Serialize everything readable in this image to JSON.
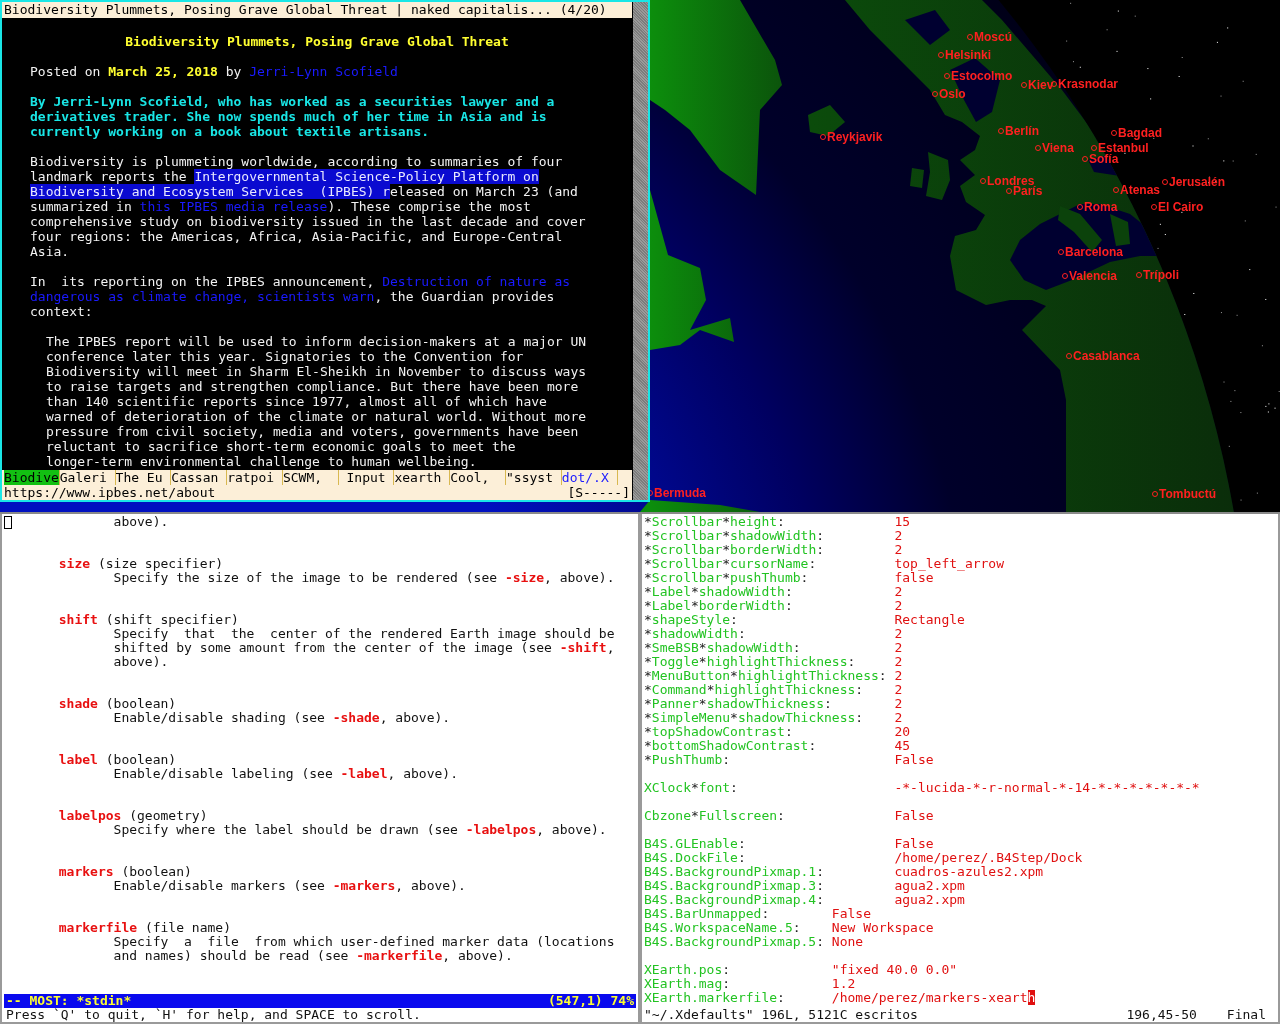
{
  "browser": {
    "title": "Biodiversity Plummets, Posing Grave Global Threat | naked capitalis... (4/20)",
    "paragraphs": [
      {
        "kind": "heading",
        "lines": [
          [
            {
              "kind": "text",
              "text": "Biodiversity Plummets, Posing Grave Global Threat"
            }
          ]
        ]
      },
      {
        "kind": "byline",
        "lines": [
          [
            {
              "kind": "text",
              "text": "Posted on "
            },
            {
              "kind": "strong",
              "text": "March 25, 2018"
            },
            {
              "kind": "text",
              "text": " by "
            },
            {
              "kind": "link",
              "text": "Jerri-Lynn Scofield"
            }
          ]
        ]
      },
      {
        "kind": "intro",
        "lines": [
          [
            {
              "kind": "text",
              "text": "By Jerri-Lynn Scofield, who has worked as a securities lawyer and a"
            }
          ],
          [
            {
              "kind": "text",
              "text": "derivatives trader. She now spends much of her time in Asia and is"
            }
          ],
          [
            {
              "kind": "text",
              "text": "currently working on a book about textile artisans."
            }
          ]
        ]
      },
      {
        "kind": "body",
        "lines": [
          [
            {
              "kind": "text",
              "text": "Biodiversity is plummeting worldwide, according to summaries of four"
            }
          ],
          [
            {
              "kind": "text",
              "text": "landmark reports the "
            },
            {
              "kind": "selected-link",
              "text": "Intergovernmental Science-Policy Platform on"
            }
          ],
          [
            {
              "kind": "selected-link",
              "text": "Biodiversity and Ecosystem Services  (IPBES) r"
            },
            {
              "kind": "text",
              "text": "eleased on March 23 (and"
            }
          ],
          [
            {
              "kind": "text",
              "text": "summarized in "
            },
            {
              "kind": "link",
              "text": "this IPBES media release"
            },
            {
              "kind": "text",
              "text": "). These comprise the most"
            }
          ],
          [
            {
              "kind": "text",
              "text": "comprehensive study on biodiversity issued in the last decade and cover"
            }
          ],
          [
            {
              "kind": "text",
              "text": "four regions: the Americas, Africa, Asia-Pacific, and Europe-Central"
            }
          ],
          [
            {
              "kind": "text",
              "text": "Asia."
            }
          ]
        ]
      },
      {
        "kind": "body",
        "lines": [
          [
            {
              "kind": "text",
              "text": "In  its reporting on the IPBES announcement, "
            },
            {
              "kind": "link",
              "text": "Destruction of nature as"
            }
          ],
          [
            {
              "kind": "link",
              "text": "dangerous as climate change, scientists warn"
            },
            {
              "kind": "text",
              "text": ", the Guardian provides"
            }
          ],
          [
            {
              "kind": "text",
              "text": "context:"
            }
          ]
        ]
      },
      {
        "kind": "quote",
        "lines": [
          [
            {
              "kind": "text",
              "text": "The IPBES report will be used to inform decision-makers at a major UN"
            }
          ],
          [
            {
              "kind": "text",
              "text": "conference later this year. Signatories to the Convention for"
            }
          ],
          [
            {
              "kind": "text",
              "text": "Biodiversity will meet in Sharm El-Sheikh in November to discuss ways"
            }
          ],
          [
            {
              "kind": "text",
              "text": "to raise targets and strengthen compliance. But there have been more"
            }
          ],
          [
            {
              "kind": "text",
              "text": "than 140 scientific reports since 1977, almost all of which have"
            }
          ],
          [
            {
              "kind": "text",
              "text": "warned of deterioration of the climate or natural world. Without more"
            }
          ],
          [
            {
              "kind": "text",
              "text": "pressure from civil society, media and voters, governments have been"
            }
          ],
          [
            {
              "kind": "text",
              "text": "reluctant to sacrifice short-term economic goals to meet the"
            }
          ],
          [
            {
              "kind": "text",
              "text": "longer-term environmental challenge to human wellbeing."
            }
          ]
        ]
      }
    ],
    "tabs": [
      {
        "label": "Biodive",
        "selected": true,
        "highlighted": false
      },
      {
        "label": "Galeri",
        "selected": false,
        "highlighted": false
      },
      {
        "label": "The Eu",
        "selected": false,
        "highlighted": false
      },
      {
        "label": "Cassan",
        "selected": false,
        "highlighted": false
      },
      {
        "label": "ratpoi",
        "selected": false,
        "highlighted": false
      },
      {
        "label": "SCWM,",
        "selected": false,
        "highlighted": false
      },
      {
        "label": " Input",
        "selected": false,
        "highlighted": false
      },
      {
        "label": "xearth",
        "selected": false,
        "highlighted": false
      },
      {
        "label": "Cool,",
        "selected": false,
        "highlighted": false
      },
      {
        "label": "\"ssyst",
        "selected": false,
        "highlighted": false
      },
      {
        "label": "dot/.X",
        "selected": false,
        "highlighted": true
      }
    ],
    "url": "https://www.ipbes.net/about",
    "status": "[S-----]"
  },
  "globe": {
    "cities": [
      "Moscú",
      "Helsinki",
      "Estocolmo",
      "Oslo",
      "Kiev",
      "Krasnodar",
      "Reykjavik",
      "Berlín",
      "Bagdad",
      "Viena",
      "Estanbul",
      "Sofía",
      "Londres",
      "París",
      "Atenas",
      "Jerusalén",
      "Roma",
      "El Cairo",
      "Barcelona",
      "Valencia",
      "Trípoli",
      "Casablanca",
      "Bermuda",
      "Tombuctú"
    ]
  },
  "manpage": {
    "lead": "above).",
    "entries": [
      {
        "term": "size",
        "arg": "(size specifier)",
        "description": [
          {
            "kind": "text",
            "text": "Specify the size of the image to be rendered (see "
          },
          {
            "kind": "ref",
            "text": "-size"
          },
          {
            "kind": "text",
            "text": ", above)."
          }
        ]
      },
      {
        "term": "shift",
        "arg": "(shift specifier)",
        "description": [
          {
            "kind": "text",
            "text": "Specify  that  the  center of the rendered Earth image should be\nshifted by some amount from the center of the image (see "
          },
          {
            "kind": "ref",
            "text": "-shift"
          },
          {
            "kind": "text",
            "text": ",\nabove)."
          }
        ]
      },
      {
        "term": "shade",
        "arg": "(boolean)",
        "description": [
          {
            "kind": "text",
            "text": "Enable/disable shading (see "
          },
          {
            "kind": "ref",
            "text": "-shade"
          },
          {
            "kind": "text",
            "text": ", above)."
          }
        ]
      },
      {
        "term": "label",
        "arg": "(boolean)",
        "description": [
          {
            "kind": "text",
            "text": "Enable/disable labeling (see "
          },
          {
            "kind": "ref",
            "text": "-label"
          },
          {
            "kind": "text",
            "text": ", above)."
          }
        ]
      },
      {
        "term": "labelpos",
        "arg": "(geometry)",
        "description": [
          {
            "kind": "text",
            "text": "Specify where the label should be drawn (see "
          },
          {
            "kind": "ref",
            "text": "-labelpos"
          },
          {
            "kind": "text",
            "text": ", above)."
          }
        ]
      },
      {
        "term": "markers",
        "arg": "(boolean)",
        "description": [
          {
            "kind": "text",
            "text": "Enable/disable markers (see "
          },
          {
            "kind": "ref",
            "text": "-markers"
          },
          {
            "kind": "text",
            "text": ", above)."
          }
        ]
      },
      {
        "term": "markerfile",
        "arg": "(file name)",
        "description": [
          {
            "kind": "text",
            "text": "Specify  a  file  from which user-defined marker data (locations\nand names) should be read (see "
          },
          {
            "kind": "ref",
            "text": "-markerfile"
          },
          {
            "kind": "text",
            "text": ", above)."
          }
        ]
      }
    ],
    "status": {
      "buffer": "-- MOST: *stdin*",
      "position": "(547,1) 74%"
    },
    "hint": "Press `Q' to quit, `H' for help, and SPACE to scroll."
  },
  "editor": {
    "blocks": [
      {
        "lines": [
          {
            "kind": "far",
            "key": "*Scrollbar*height:",
            "value": "15"
          },
          {
            "kind": "far",
            "key": "*Scrollbar*shadowWidth:",
            "value": "2"
          },
          {
            "kind": "far",
            "key": "*Scrollbar*borderWidth:",
            "value": "2"
          },
          {
            "kind": "far",
            "key": "*Scrollbar*cursorName:",
            "value": "top_left_arrow"
          },
          {
            "kind": "far",
            "key": "*Scrollbar*pushThumb:",
            "value": "false"
          },
          {
            "kind": "far",
            "key": "*Label*shadowWidth:",
            "value": "2"
          },
          {
            "kind": "far",
            "key": "*Label*borderWidth:",
            "value": "2"
          },
          {
            "kind": "far",
            "key": "*shapeStyle:",
            "value": "Rectangle"
          },
          {
            "kind": "far",
            "key": "*shadowWidth:",
            "value": "2"
          },
          {
            "kind": "far",
            "key": "*SmeBSB*shadowWidth:",
            "value": "2"
          },
          {
            "kind": "far",
            "key": "*Toggle*highlightThickness:",
            "value": "2"
          },
          {
            "kind": "far",
            "key": "*MenuButton*highlightThickness:",
            "value": "2"
          },
          {
            "kind": "far",
            "key": "*Command*highlightThickness:",
            "value": "2"
          },
          {
            "kind": "far",
            "key": "*Panner*shadowThickness:",
            "value": "2"
          },
          {
            "kind": "far",
            "key": "*SimpleMenu*shadowThickness:",
            "value": "2"
          },
          {
            "kind": "far",
            "key": "*topShadowContrast:",
            "value": "20"
          },
          {
            "kind": "far",
            "key": "*bottomShadowContrast:",
            "value": "45"
          },
          {
            "kind": "far",
            "key": "*PushThumb:",
            "value": "False"
          }
        ]
      },
      {
        "lines": [
          {
            "kind": "far",
            "key": "XClock*font:",
            "value": "-*-lucida-*-r-normal-*-14-*-*-*-*-*-*-*"
          }
        ]
      },
      {
        "lines": [
          {
            "kind": "far",
            "key": "Cbzone*Fullscreen:",
            "value": "False"
          }
        ]
      },
      {
        "lines": [
          {
            "kind": "far",
            "key": "B4S.GLEnable:",
            "value": "False"
          },
          {
            "kind": "far",
            "key": "B4S.DockFile:",
            "value": "/home/perez/.B4Step/Dock"
          },
          {
            "kind": "far",
            "key": "B4S.BackgroundPixmap.1:",
            "value": "cuadros-azules2.xpm"
          },
          {
            "kind": "far",
            "key": "B4S.BackgroundPixmap.3:",
            "value": "agua2.xpm"
          },
          {
            "kind": "far",
            "key": "B4S.BackgroundPixmap.4:",
            "value": "agua2.xpm"
          },
          {
            "kind": "near",
            "key": "B4S.BarUnmapped:",
            "value": "False"
          },
          {
            "kind": "near",
            "key": "B4S.WorkspaceName.5:",
            "value": "New Workspace"
          },
          {
            "kind": "near",
            "key": "B4S.BackgroundPixmap.5:",
            "value": "None"
          }
        ]
      },
      {
        "lines": [
          {
            "kind": "near",
            "key": "XEarth.pos:",
            "value": "\"fixed 40.0 0.0\"",
            "cursor": false
          },
          {
            "kind": "near",
            "key": "XEarth.mag:",
            "value": "1.2",
            "cursor": false
          },
          {
            "kind": "near",
            "key": "XEarth.markerfile:",
            "value": "/home/perez/markers-xearth",
            "cursor": true
          }
        ]
      }
    ],
    "status": {
      "file": "\"~/.Xdefaults\" 196L, 5121C escritos",
      "position": "196,45-50",
      "scroll": "Final"
    }
  }
}
